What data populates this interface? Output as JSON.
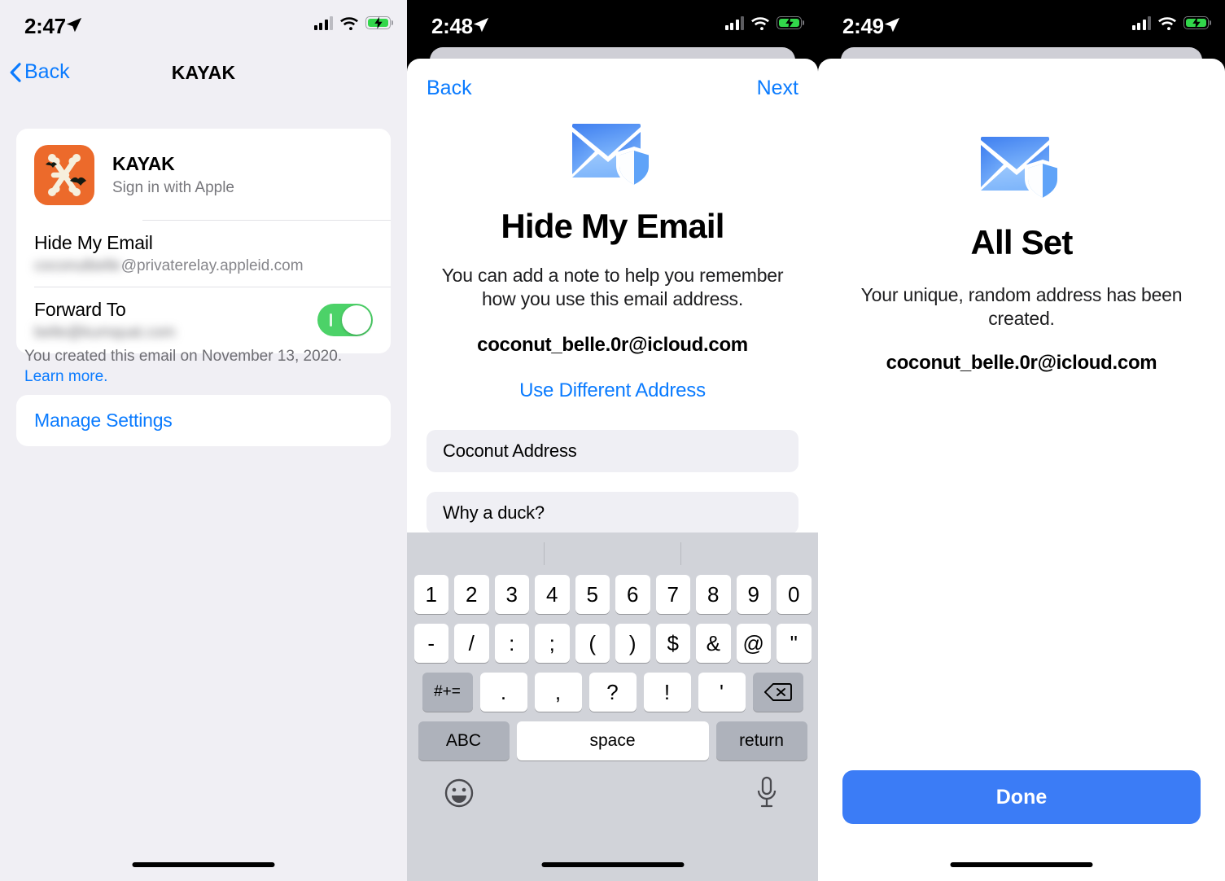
{
  "panels": {
    "settings": {
      "status": {
        "time": "2:47"
      },
      "nav": {
        "back_label": "Back",
        "title": "KAYAK"
      },
      "app": {
        "name": "KAYAK",
        "subtitle": "Sign in with Apple"
      },
      "rows": [
        {
          "label": "Hide My Email",
          "value_redacted": "coconutbelle",
          "value_visible": "@privaterelay.appleid.com"
        },
        {
          "label": "Forward To",
          "value_redacted": "belle@kumquat.com",
          "value_visible": ""
        }
      ],
      "footnote": {
        "text": "You created this email on November 13, 2020. ",
        "link": "Learn more."
      },
      "manage_settings_label": "Manage Settings"
    },
    "compose": {
      "status": {
        "time": "2:48"
      },
      "nav": {
        "back_label": "Back",
        "next_label": "Next"
      },
      "title": "Hide My Email",
      "description": "You can add a note to help you remember how you use this email address.",
      "email": "coconut_belle.0r@icloud.com",
      "use_different_label": "Use Different Address",
      "fields": [
        {
          "name": "label-field",
          "value": "Coconut Address"
        },
        {
          "name": "note-field",
          "value": "Why a duck?"
        }
      ],
      "keyboard": {
        "row1": [
          "1",
          "2",
          "3",
          "4",
          "5",
          "6",
          "7",
          "8",
          "9",
          "0"
        ],
        "row2": [
          "-",
          "/",
          ":",
          ";",
          "(",
          ")",
          "$",
          "&",
          "@",
          "\""
        ],
        "row3_symbol": "#+=",
        "row3": [
          ".",
          ",",
          "?",
          "!",
          "'"
        ],
        "row3_delete": "delete-key",
        "row4": {
          "abc": "ABC",
          "space": "space",
          "return": "return"
        },
        "bottom": {
          "emoji": "emoji-icon",
          "mic": "microphone-icon"
        }
      }
    },
    "allset": {
      "status": {
        "time": "2:49"
      },
      "title": "All Set",
      "description": "Your unique, random address has been created.",
      "email": "coconut_belle.0r@icloud.com",
      "done_label": "Done"
    }
  },
  "colors": {
    "accent_blue": "#0a7bff",
    "button_blue": "#3b7cf6",
    "toggle_green": "#4cd268",
    "kayak_orange": "#ec6a2b",
    "sheet_bg": "#ffffff",
    "settings_bg": "#f0eff4",
    "keyboard_bg": "#d1d3d9"
  }
}
